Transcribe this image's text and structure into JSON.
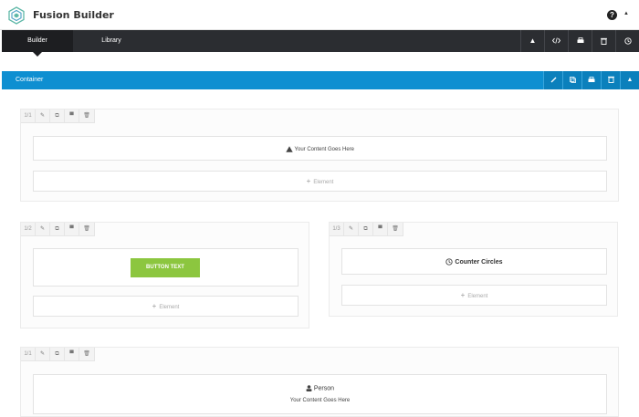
{
  "app": {
    "title": "Fusion Builder",
    "help_icon": "?"
  },
  "tabs": [
    {
      "label": "Builder",
      "active": true
    },
    {
      "label": "Library",
      "active": false
    }
  ],
  "toolbar_icons": [
    "collapse-icon",
    "code-icon",
    "save-icon",
    "trash-icon",
    "history-icon"
  ],
  "container": {
    "label": "Container",
    "icons": [
      "edit-icon",
      "clone-icon",
      "save-icon",
      "trash-icon",
      "collapse-icon"
    ]
  },
  "columns": [
    {
      "size": "1/1",
      "element": {
        "title": "Your Content Goes Here",
        "icon": "warning-icon"
      },
      "add_label": "Element"
    },
    {
      "size": "1/2",
      "button": {
        "label": "BUTTON TEXT",
        "color": "#8cc63f"
      },
      "add_label": "Element"
    },
    {
      "size": "1/3",
      "element": {
        "title": "Counter Circles",
        "icon": "clock-icon"
      },
      "add_label": "Element"
    },
    {
      "size": "1/1",
      "element": {
        "title": "Person",
        "subtitle": "Your Content Goes Here",
        "icon": "person-icon"
      }
    }
  ],
  "colors": {
    "accent": "#0e8fd1",
    "dark_bar": "#2b2d31",
    "button": "#8cc63f"
  }
}
